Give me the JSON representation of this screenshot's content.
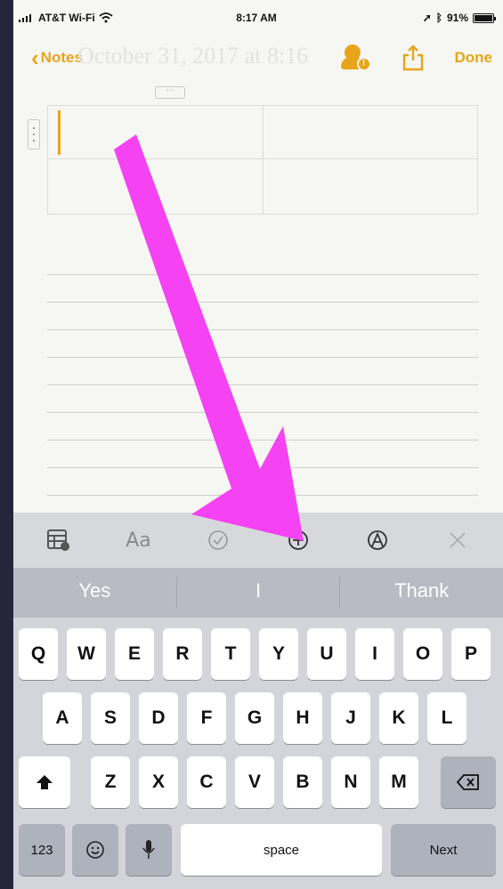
{
  "status": {
    "carrier": "AT&T Wi-Fi",
    "time": "8:17 AM",
    "battery": "91%"
  },
  "nav": {
    "back_label": "Notes",
    "done_label": "Done",
    "title_ghost": "October 31, 2017 at 8:16",
    "collab_badge": "!"
  },
  "table": {
    "handle": "···"
  },
  "toolbar": {
    "icons": [
      "table-icon",
      "text-style-icon",
      "checklist-icon",
      "add-icon",
      "sketch-icon",
      "close-icon"
    ],
    "text_style_label": "Aa"
  },
  "suggestions": [
    "Yes",
    "I",
    "Thank"
  ],
  "keyboard": {
    "row1": [
      "Q",
      "W",
      "E",
      "R",
      "T",
      "Y",
      "U",
      "I",
      "O",
      "P"
    ],
    "row2": [
      "A",
      "S",
      "D",
      "F",
      "G",
      "H",
      "J",
      "K",
      "L"
    ],
    "row3": [
      "Z",
      "X",
      "C",
      "V",
      "B",
      "N",
      "M"
    ],
    "numbers": "123",
    "space": "space",
    "next": "Next"
  },
  "colors": {
    "accent": "#e8a51a",
    "arrow": "#f542f2",
    "keyboard_bg": "#d3d5db",
    "suggestion_bg": "#b8bbc3"
  }
}
